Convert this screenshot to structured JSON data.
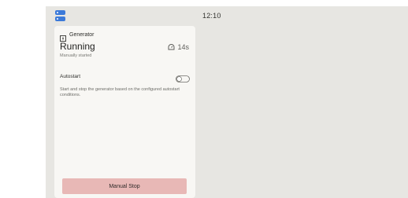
{
  "status_bar": {
    "time": "12:10",
    "menu_icon": "server-menu-icon"
  },
  "generator_card": {
    "title": "Generator",
    "title_icon": "generator-icon",
    "state": "Running",
    "runtime": "14s",
    "runtime_icon": "timer-icon",
    "reason": "Manually started",
    "autostart": {
      "label": "Autostart",
      "enabled": false,
      "description": "Start and stop the generator based on the configured autostart conditions."
    },
    "stop_button_label": "Manual Stop"
  },
  "colors": {
    "screen_bg": "#e7e6e2",
    "card_bg": "#f8f7f4",
    "accent": "#3c7ad9",
    "stop_button_bg": "#e8b8b6"
  }
}
